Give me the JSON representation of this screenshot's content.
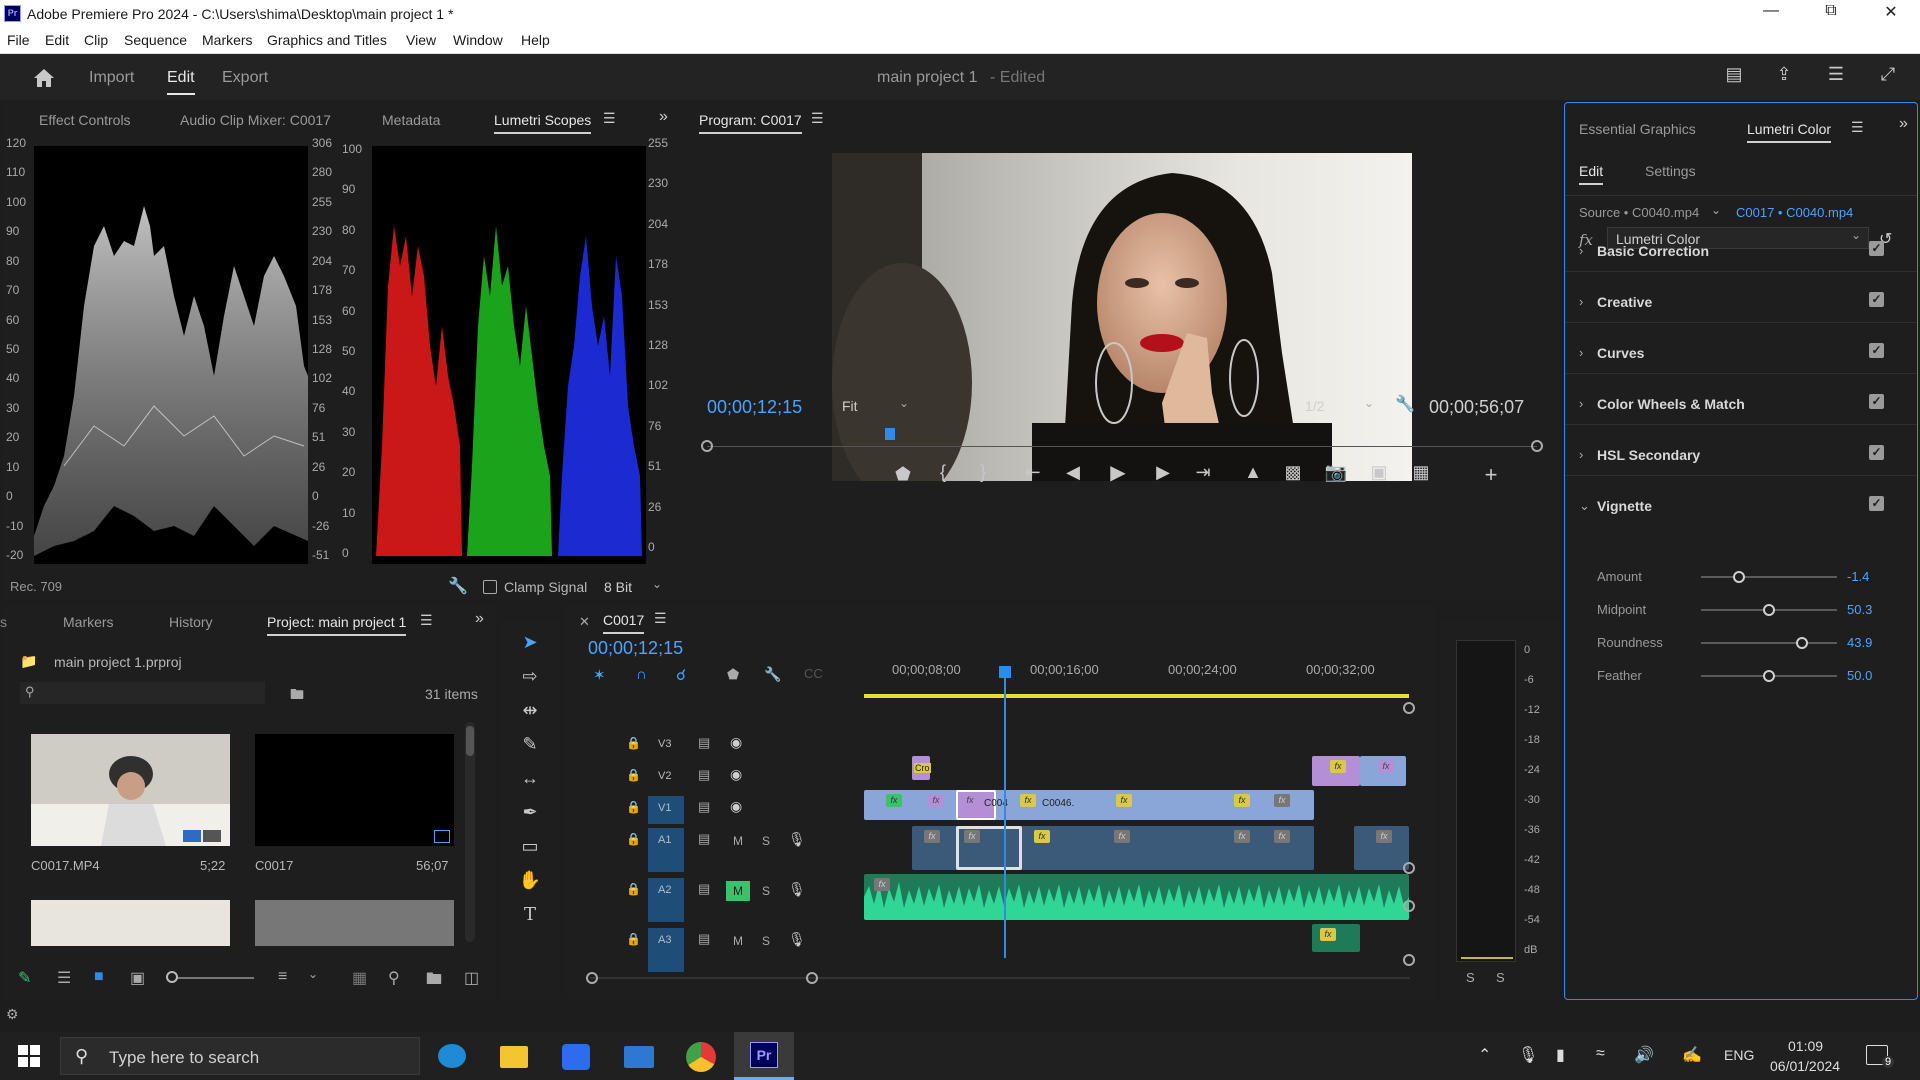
{
  "window": {
    "title": "Adobe Premiere Pro 2024 - C:\\Users\\shima\\Desktop\\main project 1 *",
    "app_icon": "Pr"
  },
  "menu": [
    "File",
    "Edit",
    "Clip",
    "Sequence",
    "Markers",
    "Graphics and Titles",
    "View",
    "Window",
    "Help"
  ],
  "header": {
    "tabs": [
      "Import",
      "Edit",
      "Export"
    ],
    "active_tab": "Edit",
    "project_name": "main project 1",
    "project_status": "- Edited"
  },
  "source_panel": {
    "tabs": [
      "Effect Controls",
      "Audio Clip Mixer: C0017",
      "Metadata",
      "Lumetri Scopes"
    ],
    "active_tab": "Lumetri Scopes",
    "waveform_left_axis": [
      "120",
      "110",
      "100",
      "90",
      "80",
      "70",
      "60",
      "50",
      "40",
      "30",
      "20",
      "10",
      "0",
      "-10",
      "-20"
    ],
    "waveform_right_axis": [
      "306",
      "280",
      "255",
      "230",
      "204",
      "178",
      "153",
      "128",
      "102",
      "76",
      "51",
      "26",
      "0",
      "-26",
      "-51"
    ],
    "parade_left_axis": [
      "100",
      "90",
      "80",
      "70",
      "60",
      "50",
      "40",
      "30",
      "20",
      "10",
      "0"
    ],
    "parade_right_axis": [
      "255",
      "230",
      "204",
      "178",
      "153",
      "128",
      "102",
      "76",
      "51",
      "26",
      "0"
    ],
    "standard": "Rec. 709",
    "clamp_signal_label": "Clamp Signal",
    "bit_depth": "8 Bit"
  },
  "program_panel": {
    "title": "Program: C0017",
    "current_time": "00;00;12;15",
    "zoom": "Fit",
    "resolution": "1/2",
    "duration": "00;00;56;07",
    "playhead_fraction": 0.22
  },
  "project_panel": {
    "tabs": [
      "Markers",
      "History",
      "Project: main project 1"
    ],
    "active_tab": "Project: main project 1",
    "file_name": "main project 1.prproj",
    "items_count": "31 items",
    "items": [
      {
        "name": "C0017.MP4",
        "duration": "5;22"
      },
      {
        "name": "C0017",
        "duration": "56;07"
      }
    ]
  },
  "timeline": {
    "sequence_name": "C0017",
    "timecode": "00;00;12;15",
    "ruler_labels": [
      "00;00;08;00",
      "00;00;16;00",
      "00;00;24;00",
      "00;00;32;00"
    ],
    "tracks": [
      {
        "id": "V3",
        "kind": "video"
      },
      {
        "id": "V2",
        "kind": "video"
      },
      {
        "id": "V1",
        "kind": "video"
      },
      {
        "id": "A1",
        "kind": "audio"
      },
      {
        "id": "A2",
        "kind": "audio"
      },
      {
        "id": "A3",
        "kind": "audio"
      }
    ],
    "audio_buttons": {
      "mute": "M",
      "solo": "S"
    },
    "clip_labels": [
      "Cro",
      "C004",
      "C0046."
    ]
  },
  "audio_meter": {
    "scale": [
      "0",
      "-6",
      "-12",
      "-18",
      "-24",
      "-30",
      "-36",
      "-42",
      "-48",
      "-54",
      "dB"
    ],
    "solo_labels": [
      "S",
      "S"
    ]
  },
  "lumetri": {
    "tabs": [
      "Essential Graphics",
      "Lumetri Color"
    ],
    "active_tab": "Lumetri Color",
    "subtabs": [
      "Edit",
      "Settings"
    ],
    "source": "Source • C0040.mp4",
    "target": "C0017 • C0040.mp4",
    "effect": "Lumetri Color",
    "sections": [
      "Basic Correction",
      "Creative",
      "Curves",
      "Color Wheels & Match",
      "HSL Secondary",
      "Vignette"
    ],
    "vignette": [
      {
        "label": "Amount",
        "value": "-1.4",
        "fraction": 0.28
      },
      {
        "label": "Midpoint",
        "value": "50.3",
        "fraction": 0.5
      },
      {
        "label": "Roundness",
        "value": "43.9",
        "fraction": 0.74
      },
      {
        "label": "Feather",
        "value": "50.0",
        "fraction": 0.5
      }
    ]
  },
  "taskbar": {
    "search_placeholder": "Type here to search",
    "language": "ENG",
    "time": "01:09",
    "date": "06/01/2024",
    "notifications": "9"
  },
  "colors": {
    "accent_blue": "#2d8ceb",
    "timecode_blue": "#4aa3ff",
    "video_clip": "#8aa5d8",
    "audio_clip": "#2fb58a",
    "adjustment_clip": "#b48fd6"
  }
}
